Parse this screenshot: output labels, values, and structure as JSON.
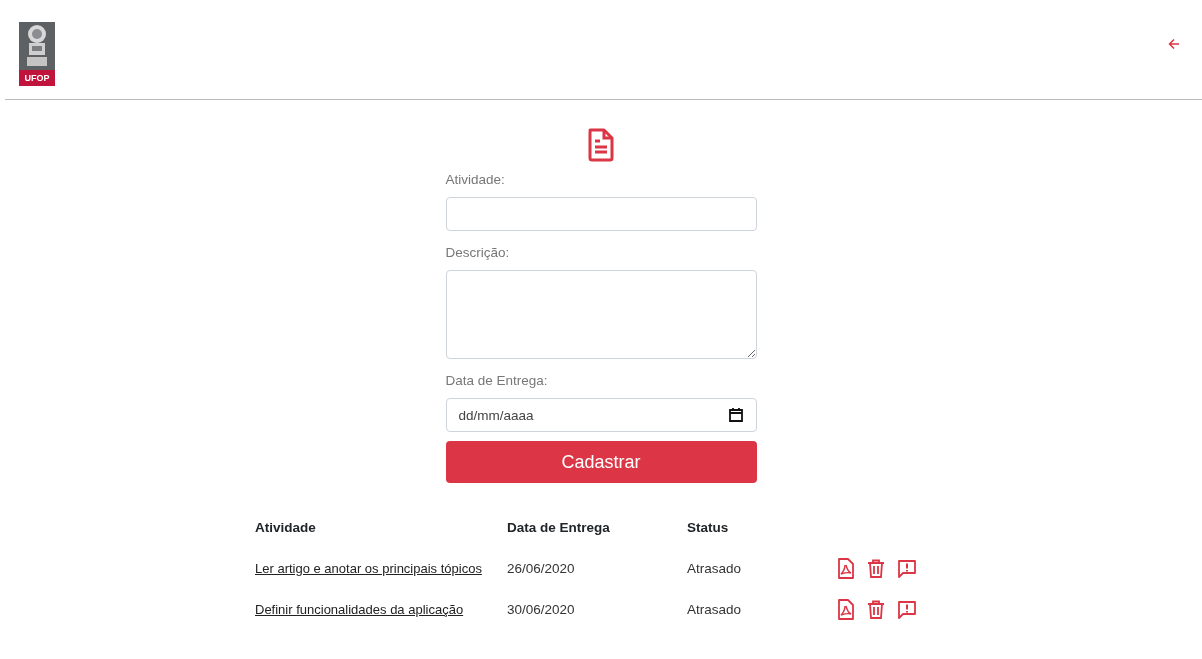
{
  "header": {
    "logo_text": "UFOP"
  },
  "form": {
    "fields": [
      {
        "kind": "text",
        "label": "Atividade:"
      },
      {
        "kind": "textarea",
        "label": "Descrição:"
      },
      {
        "kind": "date",
        "label": "Data de Entrega:",
        "placeholder": "dd/mm/aaaa"
      }
    ],
    "submit": "Cadastrar"
  },
  "table": {
    "columns": [
      "Atividade",
      "Data de Entrega",
      "Status"
    ],
    "rows": [
      {
        "activity": "Ler artigo e anotar os principais tópicos",
        "due": "26/06/2020",
        "status": "Atrasado"
      },
      {
        "activity": "Definir funcionalidades da aplicação",
        "due": "30/06/2020",
        "status": "Atrasado"
      }
    ]
  }
}
